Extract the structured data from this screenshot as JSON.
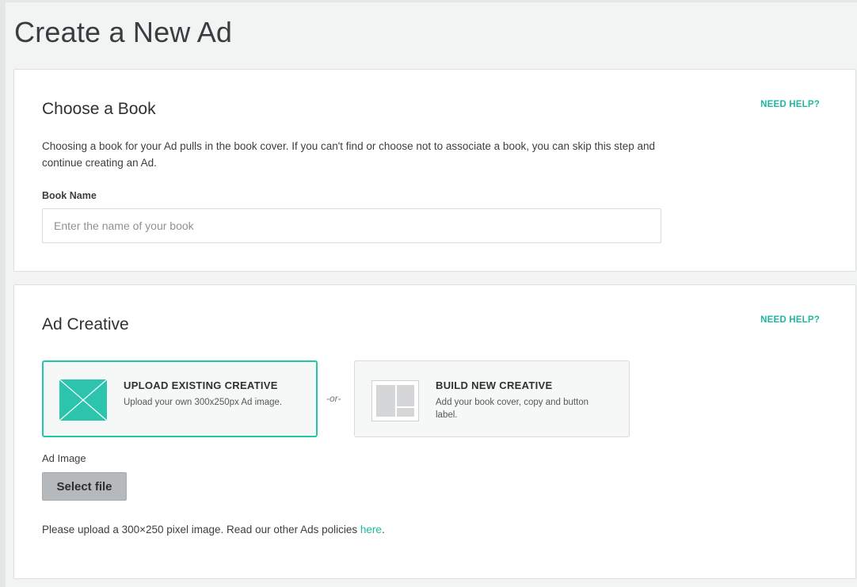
{
  "page": {
    "title": "Create a New Ad"
  },
  "book_section": {
    "title": "Choose a Book",
    "help": "NEED HELP?",
    "description": "Choosing a book for your Ad pulls in the book cover. If you can't find or choose not to associate a book, you can skip this step and continue creating an Ad.",
    "field_label": "Book Name",
    "input_value": "",
    "input_placeholder": "Enter the name of your book"
  },
  "creative_section": {
    "title": "Ad Creative",
    "help": "NEED HELP?",
    "options": [
      {
        "title": "UPLOAD EXISTING CREATIVE",
        "subtitle": "Upload your own 300x250px Ad image.",
        "selected": true,
        "icon": "image-placeholder-icon"
      },
      {
        "title": "BUILD NEW CREATIVE",
        "subtitle": "Add your book cover, copy and button label.",
        "selected": false,
        "icon": "layout-template-icon"
      }
    ],
    "or_text": "-or-",
    "image_label": "Ad Image",
    "select_file": "Select file",
    "policy_text": "Please upload a 300×250 pixel image. Read our other Ads policies ",
    "policy_link": "here",
    "policy_end": "."
  },
  "colors": {
    "accent": "#1fb9a0",
    "selected_border": "#23c5ab",
    "button_bg": "#b6b9bb"
  }
}
